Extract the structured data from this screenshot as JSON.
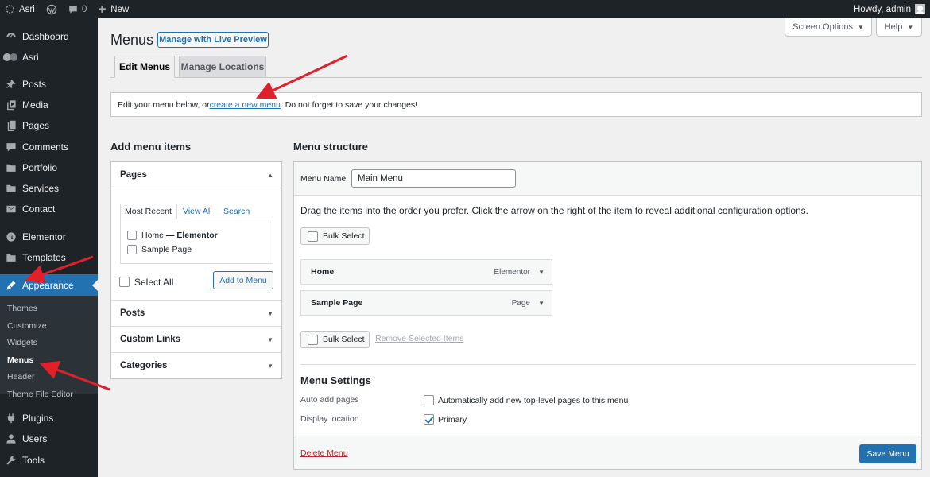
{
  "adminbar": {
    "site_name": "Asri",
    "comments_count": "0",
    "new_label": "New",
    "greeting": "Howdy, admin"
  },
  "sidebar": {
    "items": [
      {
        "label": "Dashboard",
        "icon": "dashboard-icon"
      },
      {
        "label": "Asri",
        "icon": "asri-icon"
      },
      {
        "label": "Posts",
        "icon": "pin-icon"
      },
      {
        "label": "Media",
        "icon": "media-icon"
      },
      {
        "label": "Pages",
        "icon": "pages-icon"
      },
      {
        "label": "Comments",
        "icon": "comment-icon"
      },
      {
        "label": "Portfolio",
        "icon": "folder-icon"
      },
      {
        "label": "Services",
        "icon": "folder-icon"
      },
      {
        "label": "Contact",
        "icon": "mail-icon"
      },
      {
        "label": "Elementor",
        "icon": "elementor-icon"
      },
      {
        "label": "Templates",
        "icon": "folder-icon"
      },
      {
        "label": "Appearance",
        "icon": "brush-icon"
      },
      {
        "label": "Plugins",
        "icon": "plugin-icon"
      },
      {
        "label": "Users",
        "icon": "user-icon"
      },
      {
        "label": "Tools",
        "icon": "wrench-icon"
      }
    ],
    "submenu": [
      "Themes",
      "Customize",
      "Widgets",
      "Menus",
      "Header",
      "Theme File Editor"
    ]
  },
  "header": {
    "title": "Menus",
    "live_preview": "Manage with Live Preview",
    "screen_options": "Screen Options",
    "help": "Help"
  },
  "tabs": [
    "Edit Menus",
    "Manage Locations"
  ],
  "notice": {
    "before": "Edit your menu below, or ",
    "link": "create a new menu",
    "after": ". Do not forget to save your changes!"
  },
  "add_items": {
    "heading": "Add menu items",
    "pages_title": "Pages",
    "subtabs": [
      "Most Recent",
      "View All",
      "Search"
    ],
    "pages": [
      {
        "title": "Home",
        "suffix": " — Elementor"
      },
      {
        "title": "Sample Page",
        "suffix": ""
      }
    ],
    "select_all": "Select All",
    "add_button": "Add to Menu",
    "other_sections": [
      "Posts",
      "Custom Links",
      "Categories"
    ]
  },
  "structure": {
    "heading": "Menu structure",
    "menu_name_label": "Menu Name",
    "menu_name_value": "Main Menu",
    "instructions": "Drag the items into the order you prefer. Click the arrow on the right of the item to reveal additional configuration options.",
    "bulk_select": "Bulk Select",
    "items": [
      {
        "title": "Home",
        "type": "Elementor"
      },
      {
        "title": "Sample Page",
        "type": "Page"
      }
    ],
    "remove_selected": "Remove Selected Items",
    "settings_heading": "Menu Settings",
    "auto_add_label": "Auto add pages",
    "auto_add_text": "Automatically add new top-level pages to this menu",
    "auto_add_checked": false,
    "display_location_label": "Display location",
    "location_text": "Primary",
    "location_checked": true,
    "delete_menu": "Delete Menu",
    "save_menu": "Save Menu"
  },
  "colors": {
    "accent": "#2271b1",
    "annotation_arrow": "#e0202a",
    "danger": "#b32d2e"
  }
}
